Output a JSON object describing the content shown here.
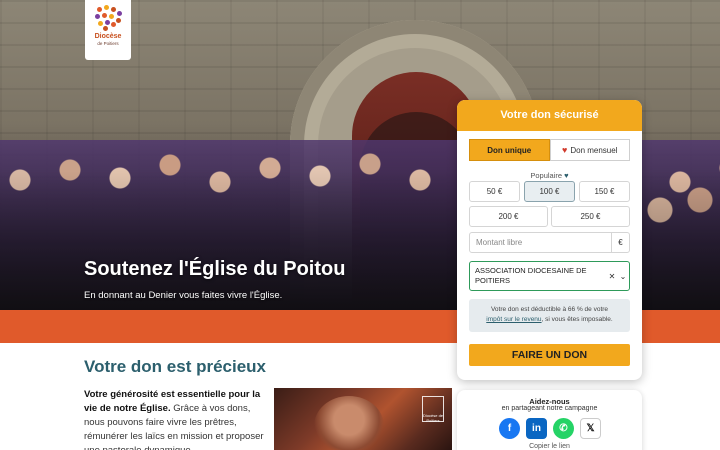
{
  "logo": {
    "name": "Diocèse",
    "sub": "de Poitiers"
  },
  "hero": {
    "title": "Soutenez l'Église du Poitou",
    "subtitle": "En donnant au Denier vous faites vivre l'Église."
  },
  "content": {
    "title": "Votre don est précieux",
    "intro_bold": "Votre générosité est essentielle pour la vie de notre Église.",
    "intro_text": " Grâce à vos dons, nous pouvons faire vivre les prêtres, rémunérer les laïcs en mission et proposer une pastorale dynamique",
    "photo_stamp": "Diocèse de Poitiers"
  },
  "donation": {
    "header": "Votre don sécurisé",
    "tabs": [
      "Don unique",
      "Don mensuel"
    ],
    "active_tab": "Don unique",
    "popular_label": "Populaire",
    "amounts": [
      "50 €",
      "100 €",
      "150 €",
      "200 €",
      "250 €"
    ],
    "selected_amount": "100 €",
    "free_amount_placeholder": "Montant libre",
    "currency": "€",
    "beneficiary_line1": "ASSOCIATION DIOCESAINE DE",
    "beneficiary_line2": "POITIERS",
    "tax_text1": "Votre don est déductible à 66 % de votre",
    "tax_link": "impôt sur le revenu",
    "tax_text2": ", si vous êtes imposable.",
    "cta": "FAIRE UN DON"
  },
  "share": {
    "title": "Aidez-nous",
    "subtitle": "en partageant notre campagne",
    "copy_link": "Copier le lien",
    "networks": [
      "facebook-icon",
      "linkedin-icon",
      "whatsapp-icon",
      "x-icon"
    ]
  },
  "colors": {
    "accent": "#f2a81d",
    "band": "#e05a2b",
    "teal": "#2c5f6d"
  }
}
